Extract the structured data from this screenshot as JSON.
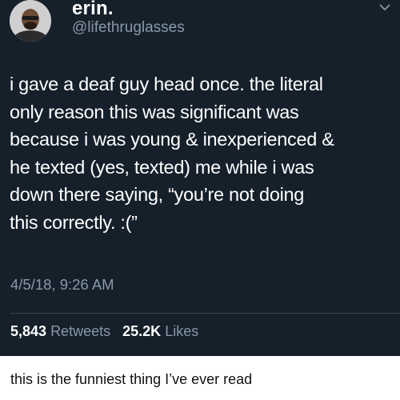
{
  "tweet": {
    "display_name": "erin.",
    "handle": "@lifethruglasses",
    "text_lines": [
      "i gave a deaf guy head once. the literal",
      "only reason this was significant was",
      "because i was young & inexperienced &",
      "he texted (yes, texted) me while i was",
      "down there saying, “you’re not doing",
      "this correctly. :(”"
    ],
    "timestamp": "4/5/18, 9:26 AM",
    "retweets_count": "5,843",
    "retweets_label": "Retweets",
    "likes_count": "25.2K",
    "likes_label": "Likes",
    "icon": "chevron-down-icon"
  },
  "caption": "this is the funniest thing I’ve ever read",
  "colors": {
    "card_background": "#15202b",
    "secondary_text": "#8899a6",
    "divider": "#38444d"
  }
}
